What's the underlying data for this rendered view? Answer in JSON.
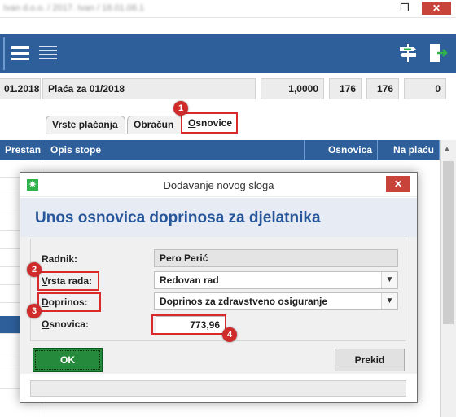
{
  "window": {
    "title": "Ivan d.o.o. / 2017. Ivan / 18.01.08.1",
    "restore_glyph": "❐",
    "close_glyph": "✕"
  },
  "toolbar": {
    "menu_icon": "hamburger-menu-icon",
    "list_icon": "list-icon",
    "signpost_icon": "signpost-icon",
    "exit_icon": "exit-door-icon",
    "color": "#2e5f9b"
  },
  "info_row": {
    "date": "01.2018",
    "placa": "Plaća za 01/2018",
    "factor": "1,0000",
    "hours_a": "176",
    "hours_b": "176",
    "count": "0"
  },
  "tabs": [
    {
      "label": "Vrste plaćanja",
      "u": "V",
      "rest": "rste plaćanja"
    },
    {
      "label": "Obračun",
      "u": "",
      "rest": "Obračun"
    },
    {
      "label": "Osnovice",
      "u": "O",
      "rest": "snovice"
    }
  ],
  "grid": {
    "left_header": "Prestan",
    "columns": [
      "Opis stope",
      "Osnovica",
      "Na plaću"
    ]
  },
  "dialog": {
    "title": "Dodavanje novog sloga",
    "close_glyph": "✕",
    "heading": "Unos osnovica doprinosa za djelatnika",
    "radnik_label": "Radnik:",
    "radnik_value": "Pero Perić",
    "vrsta_label": "Vrsta rada:",
    "vrsta_u": "V",
    "vrsta_rest": "rsta rada:",
    "vrsta_value": "Redovan rad",
    "doprinos_label": "Doprinos:",
    "doprinos_u": "D",
    "doprinos_rest": "oprinos:",
    "doprinos_value": "Doprinos za zdravstveno osiguranje",
    "osnovica_label": "Osnovica:",
    "osnovica_u": "O",
    "osnovica_rest": "snovica:",
    "osnovica_value": "773,96",
    "ok_label": "OK",
    "prekid_label": "Prekid",
    "dropdown_glyph": "▼"
  },
  "callouts": [
    "1",
    "2",
    "3",
    "4"
  ],
  "colors": {
    "accent": "#2e5f9b",
    "highlight": "#d9292b",
    "ok_green": "#258a3b"
  }
}
